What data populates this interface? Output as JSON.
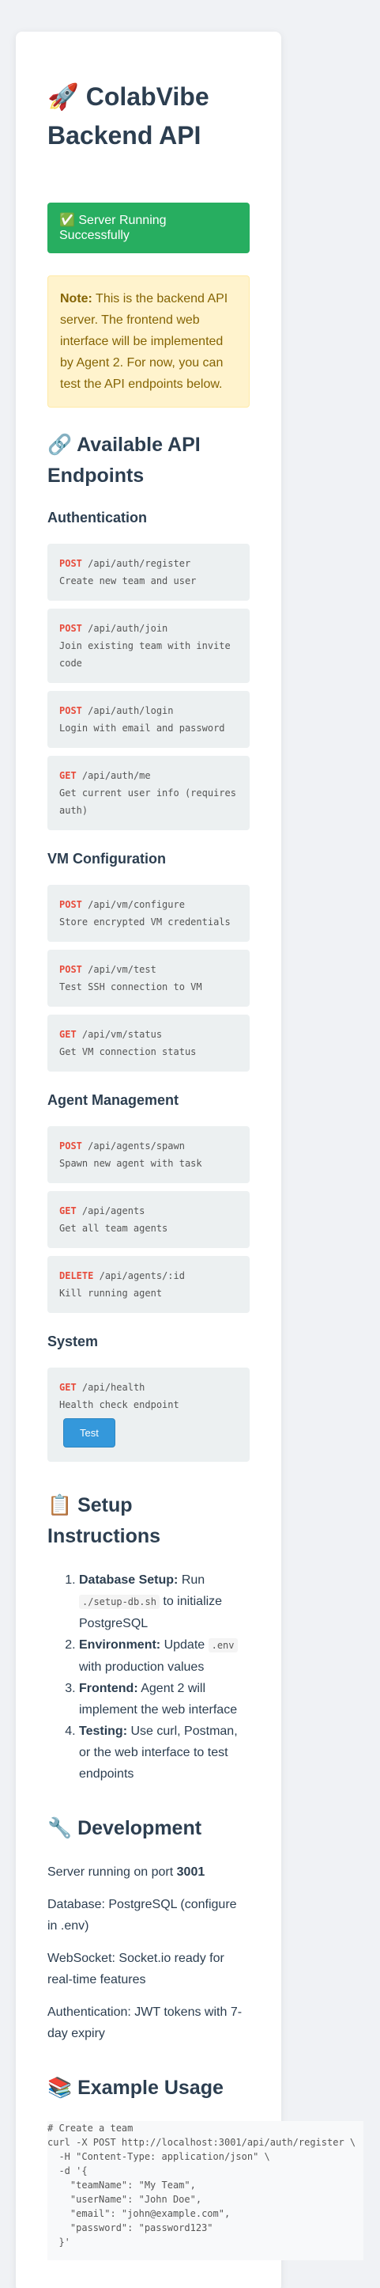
{
  "title": "🚀 ColabVibe Backend API",
  "status": "✅ Server Running Successfully",
  "note": {
    "label": "Note:",
    "text": " This is the backend API server. The frontend web interface will be implemented by Agent 2. For now, you can test the API endpoints below."
  },
  "endpoints_heading": "🔗 Available API Endpoints",
  "groups": {
    "auth": {
      "title": "Authentication",
      "items": [
        {
          "method": "POST",
          "path": "/api/auth/register",
          "desc": "Create new team and user"
        },
        {
          "method": "POST",
          "path": "/api/auth/join",
          "desc": "Join existing team with invite code"
        },
        {
          "method": "POST",
          "path": "/api/auth/login",
          "desc": "Login with email and password"
        },
        {
          "method": "GET",
          "path": "/api/auth/me",
          "desc": "Get current user info (requires auth)"
        }
      ]
    },
    "vm": {
      "title": "VM Configuration",
      "items": [
        {
          "method": "POST",
          "path": "/api/vm/configure",
          "desc": "Store encrypted VM credentials"
        },
        {
          "method": "POST",
          "path": "/api/vm/test",
          "desc": "Test SSH connection to VM"
        },
        {
          "method": "GET",
          "path": "/api/vm/status",
          "desc": "Get VM connection status"
        }
      ]
    },
    "agents": {
      "title": "Agent Management",
      "items": [
        {
          "method": "POST",
          "path": "/api/agents/spawn",
          "desc": "Spawn new agent with task"
        },
        {
          "method": "GET",
          "path": "/api/agents",
          "desc": "Get all team agents"
        },
        {
          "method": "DELETE",
          "path": "/api/agents/:id",
          "desc": "Kill running agent"
        }
      ]
    },
    "system": {
      "title": "System",
      "items": [
        {
          "method": "GET",
          "path": "/api/health",
          "desc": "Health check endpoint",
          "button": "Test"
        }
      ]
    }
  },
  "setup": {
    "heading": "📋 Setup Instructions",
    "steps": [
      {
        "label": "Database Setup:",
        "pre": " Run ",
        "code": "./setup-db.sh",
        "post": " to initialize PostgreSQL"
      },
      {
        "label": "Environment:",
        "pre": " Update ",
        "code": ".env",
        "post": " with production values"
      },
      {
        "label": "Frontend:",
        "pre": " Agent 2 will implement the web interface",
        "code": "",
        "post": ""
      },
      {
        "label": "Testing:",
        "pre": " Use curl, Postman, or the web interface to test endpoints",
        "code": "",
        "post": ""
      }
    ]
  },
  "development": {
    "heading": "🔧 Development",
    "port_label": "Server running on port ",
    "port": "3001",
    "lines": [
      "Database: PostgreSQL (configure in .env)",
      "WebSocket: Socket.io ready for real-time features",
      "Authentication: JWT tokens with 7-day expiry"
    ]
  },
  "example": {
    "heading": "📚 Example Usage",
    "code": "# Create a team\ncurl -X POST http://localhost:3001/api/auth/register \\\n  -H \"Content-Type: application/json\" \\\n  -d '{\n    \"teamName\": \"My Team\",\n    \"userName\": \"John Doe\",\n    \"email\": \"john@example.com\",\n    \"password\": \"password123\"\n  }'"
  },
  "colors": {
    "method": "#e74c3c",
    "status_bg": "#27ae60",
    "button_bg": "#3498db",
    "note_bg": "#fff3cd"
  }
}
